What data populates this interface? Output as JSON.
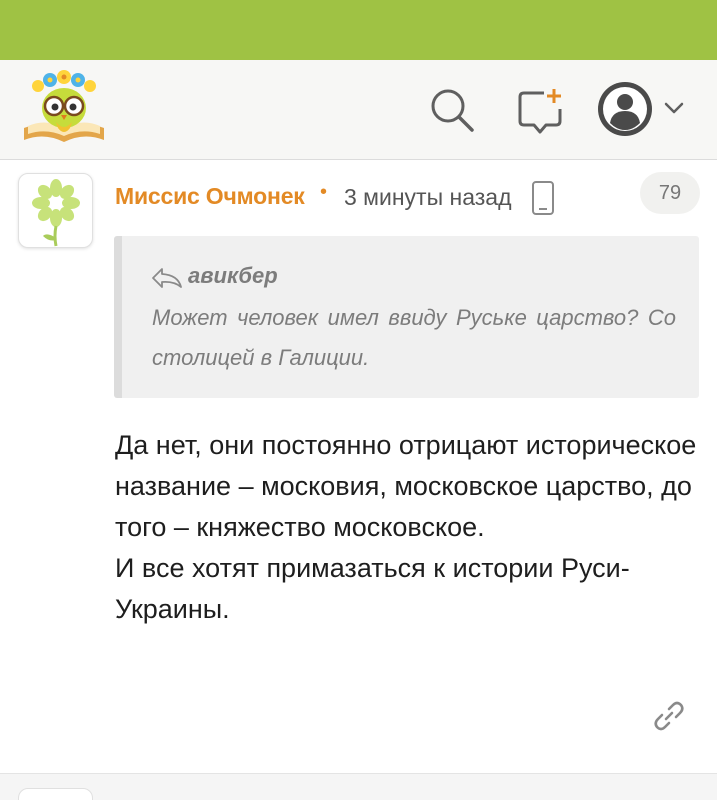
{
  "header": {
    "logo_icon": "owl-book-logo",
    "search_icon": "search-icon",
    "new_post_icon": "new-post-icon",
    "avatar_icon": "user-avatar-icon",
    "menu_icon": "chevron-down-icon"
  },
  "comment": {
    "author": "Миссис Очмонек",
    "separator": "•",
    "time": "3 минуты назад",
    "device_icon": "mobile-phone-icon",
    "votes": "79",
    "quote": {
      "author": "авикбер",
      "text": "Может человек имел ввиду Руське царство? Со столицей в Галиции."
    },
    "text": "Да нет, они постоянно отрицают историческое название – московия, московское царство, до того – княжество московское.\nИ все хотят примазаться к истории Руси-Украины.",
    "link_icon": "link-icon"
  },
  "colors": {
    "topbar": "#9fc244",
    "accent": "#e38a25",
    "quote_bg": "#f0f0f0"
  }
}
